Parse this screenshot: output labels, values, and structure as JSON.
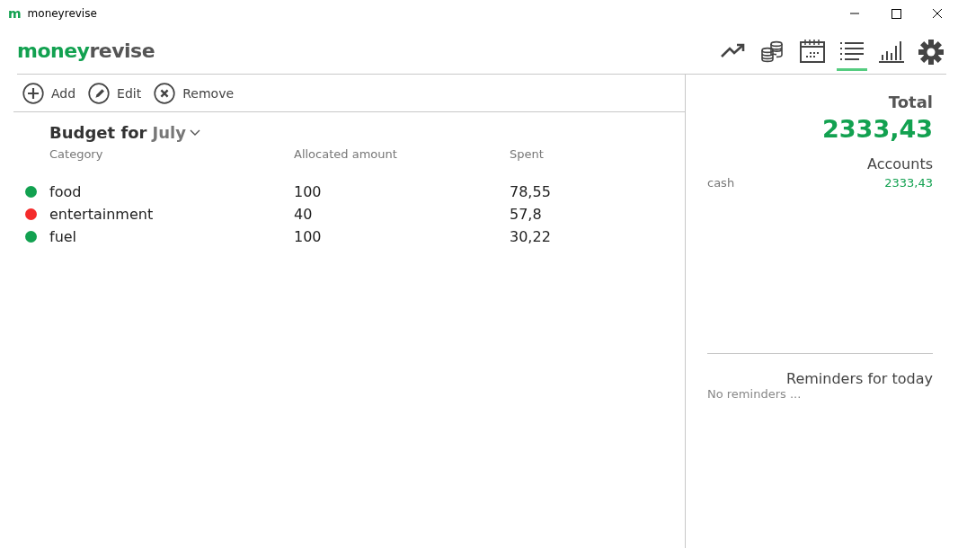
{
  "window": {
    "app_icon": "m",
    "title": "moneyrevise"
  },
  "logo": {
    "first": "money",
    "second": "revise"
  },
  "nav": [
    {
      "kind": "trend",
      "selected": false
    },
    {
      "kind": "coins",
      "selected": false
    },
    {
      "kind": "calendar",
      "selected": false
    },
    {
      "kind": "list",
      "selected": true
    },
    {
      "kind": "bars",
      "selected": false
    },
    {
      "kind": "gear",
      "selected": false
    }
  ],
  "toolbar": [
    {
      "kind": "add",
      "label": "Add"
    },
    {
      "kind": "edit",
      "label": "Edit"
    },
    {
      "kind": "remove",
      "label": "Remove"
    }
  ],
  "budget": {
    "title": "Budget for",
    "month": "July"
  },
  "table": {
    "columns": [
      "Category",
      "Allocated amount",
      "Spent"
    ],
    "rows": [
      {
        "color": "#12a150",
        "category": "food",
        "allocated": "100",
        "spent": "78,55"
      },
      {
        "color": "#f42b2b",
        "category": "entertainment",
        "allocated": "40",
        "spent": "57,8"
      },
      {
        "color": "#12a150",
        "category": "fuel",
        "allocated": "100",
        "spent": "30,22"
      }
    ]
  },
  "summary": {
    "total_label": "Total",
    "total": "2333,43",
    "accounts_label": "Accounts",
    "accounts": [
      {
        "name": "cash",
        "amount": "2333,43"
      }
    ],
    "reminders_label": "Reminders for today",
    "reminders_empty": "No reminders ..."
  }
}
